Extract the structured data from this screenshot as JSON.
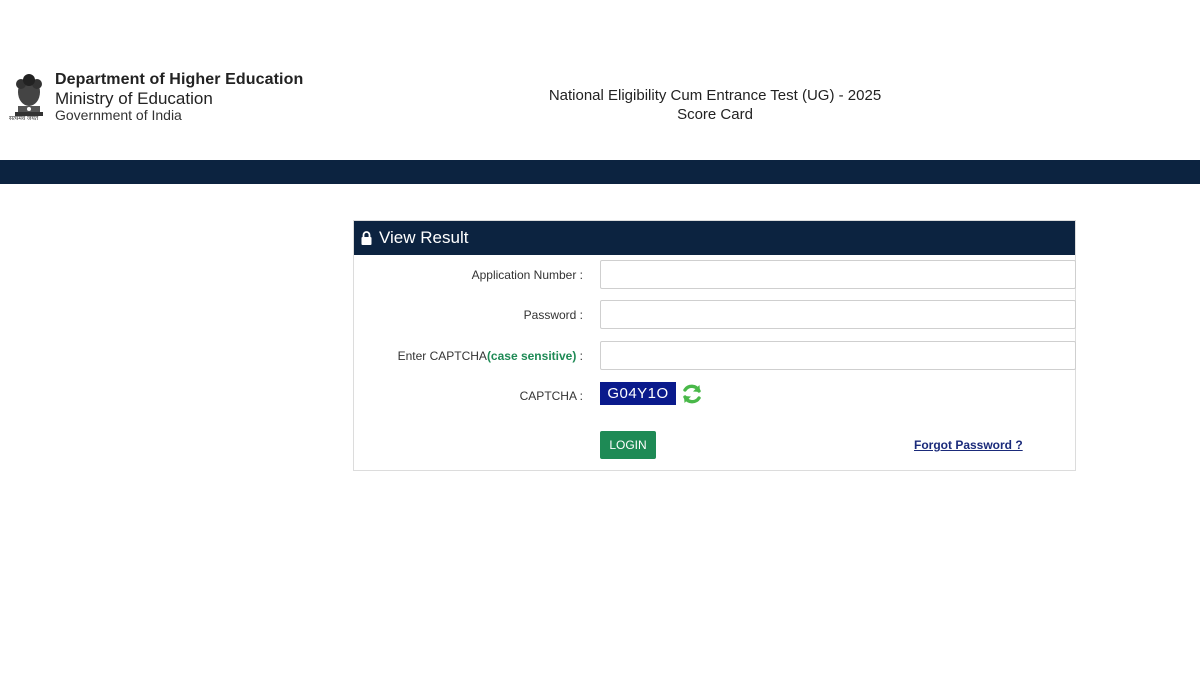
{
  "header": {
    "emblem_caption": "सत्यमेव जयते",
    "dept_line1": "Department of Higher Education",
    "dept_line2": "Ministry of Education",
    "dept_line3": "Government of India",
    "exam_title": "National Eligibility Cum Entrance Test (UG) - 2025",
    "exam_subtitle": "Score Card"
  },
  "panel": {
    "title": "View Result",
    "title_icon": "lock-icon",
    "application_label": "Application Number :",
    "application_value": "",
    "password_label": "Password :",
    "password_value": "",
    "captcha_input_label": "Enter CAPTCHA",
    "captcha_case_note": "(case sensitive)",
    "captcha_input_suffix": " :",
    "captcha_input_value": "",
    "captcha_label": "CAPTCHA :",
    "captcha_text": "G04Y1O",
    "refresh_icon": "refresh-icon",
    "login_label": "LOGIN",
    "forgot_label": "Forgot Password ?"
  },
  "colors": {
    "navy": "#0c2340",
    "green": "#1e8a55",
    "captcha_bg": "#0a1a8c",
    "link": "#1a2a7a"
  }
}
